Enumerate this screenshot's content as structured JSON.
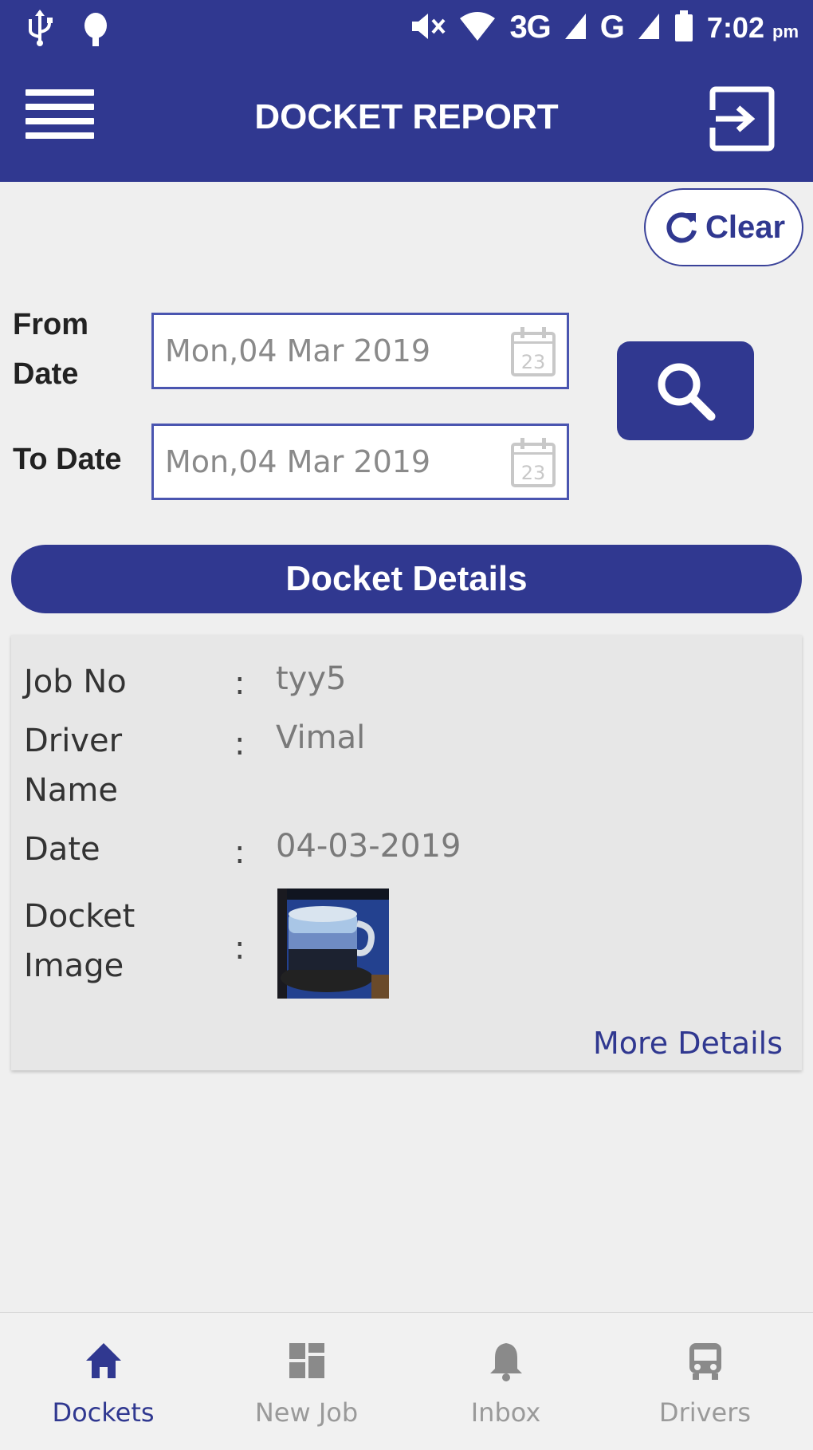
{
  "status_bar": {
    "network": "3G",
    "network2": "G",
    "time": "7:02",
    "ampm": "pm"
  },
  "app_bar": {
    "title": "DOCKET REPORT"
  },
  "filters": {
    "clear_label": "Clear",
    "from_label": "From Date",
    "from_value": "Mon,04 Mar 2019",
    "to_label": "To Date",
    "to_value": "Mon,04 Mar 2019",
    "calendar_glyph": "23"
  },
  "section": {
    "title": "Docket Details"
  },
  "docket": {
    "job_no_label": "Job No",
    "job_no": "tyy5",
    "driver_label": "Driver Name",
    "driver": "Vimal",
    "date_label": "Date",
    "date": "04-03-2019",
    "image_label": "Docket Image",
    "separator": ":",
    "more_label": "More Details"
  },
  "bottom_nav": {
    "items": [
      {
        "label": "Dockets",
        "icon": "home-icon"
      },
      {
        "label": "New Job",
        "icon": "grid-icon"
      },
      {
        "label": "Inbox",
        "icon": "bell-icon"
      },
      {
        "label": "Drivers",
        "icon": "bus-icon"
      }
    ],
    "active": "Dockets"
  },
  "colors": {
    "primary": "#303890",
    "background": "#efefef",
    "card": "#e7e7e7"
  }
}
